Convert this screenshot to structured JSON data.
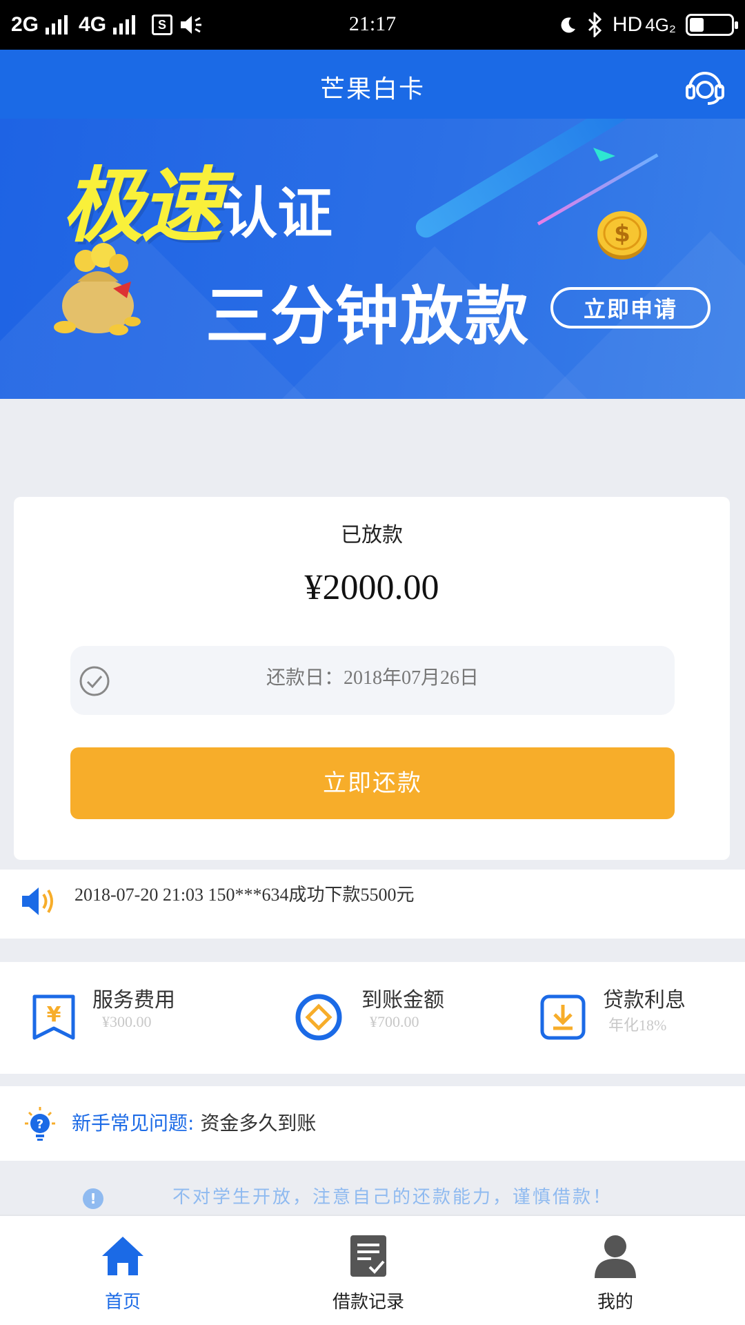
{
  "status_bar": {
    "network_1": "2G",
    "network_2": "4G",
    "time": "21:17",
    "hd": "HD",
    "data_type": "4G₂",
    "battery_level": 0.35
  },
  "header": {
    "title": "芒果白卡",
    "service_icon": "headset-icon"
  },
  "banner": {
    "headline_highlight": "极速",
    "headline_rest": "认证",
    "subline": "三分钟放款",
    "apply_button": "立即申请"
  },
  "loan_card": {
    "status": "已放款",
    "amount": "¥2000.00",
    "due_date": "还款日：2018年07月26日",
    "repay_button": "立即还款"
  },
  "notice": {
    "text": "2018-07-20 21:03 150***634成功下款5500元"
  },
  "features": [
    {
      "label": "服务费用",
      "value": "¥300.00",
      "icon": "receipt-yuan-icon"
    },
    {
      "label": "到账金额",
      "value": "¥700.00",
      "icon": "coin-icon"
    },
    {
      "label": "贷款利息",
      "value": "年化18%",
      "icon": "download-icon"
    }
  ],
  "faq": {
    "label": "新手常见问题:",
    "question": "资金多久到账"
  },
  "warning": {
    "text": "不对学生开放，注意自己的还款能力，谨慎借款！"
  },
  "tabs": [
    {
      "label": "首页",
      "icon": "home-icon",
      "active": true
    },
    {
      "label": "借款记录",
      "icon": "records-icon",
      "active": false
    },
    {
      "label": "我的",
      "icon": "user-icon",
      "active": false
    }
  ],
  "colors": {
    "primary": "#1b6ae6",
    "accent": "#f7ad2a",
    "banner_yellow": "#f9f03a",
    "warning_text": "#8fbaf0"
  }
}
